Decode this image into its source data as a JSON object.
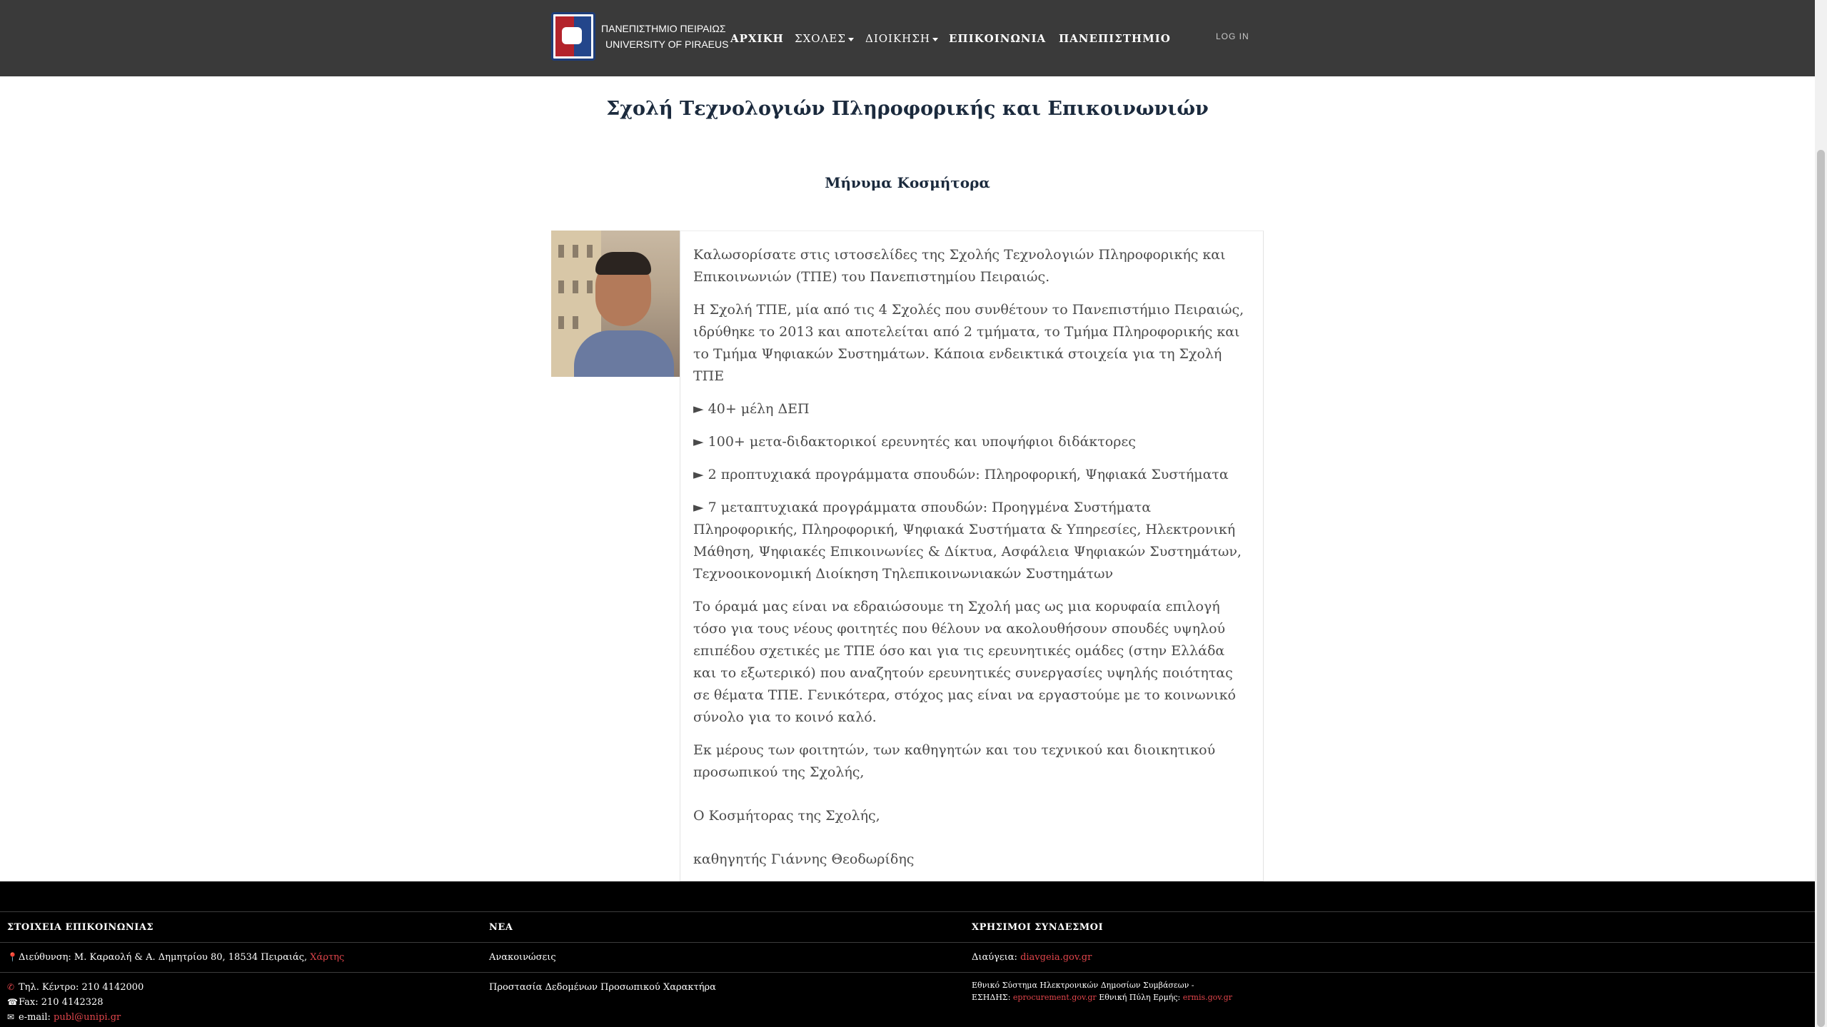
{
  "nav": {
    "brand_gr": "ΠΑΝΕΠΙΣΤΗΜΙΟ ΠΕΙΡΑΙΩΣ",
    "brand_en": "UNIVERSITY OF PIRAEUS",
    "items": [
      {
        "label": "ΑΡΧΙΚΗ"
      },
      {
        "label": "ΣΧΟΛΕΣ"
      },
      {
        "label": "ΔΙΟΙΚΗΣΗ"
      },
      {
        "label": "ΕΠΙΚΟΙΝΩΝΙΑ"
      },
      {
        "label": "ΠΑΝΕΠΙΣΤΗΜΙΟ"
      }
    ],
    "login": "LOG IN"
  },
  "page": {
    "title": "Σχολή Τεχνολογιών Πληροφορικής και Επικοινωνιών",
    "subtitle": "Μήνυμα Κοσμήτορα"
  },
  "message": {
    "p1": "Καλωσορίσατε στις ιστοσελίδες της Σχολής Τεχνολογιών Πληροφορικής και Επικοινωνιών (ΤΠΕ) του Πανεπιστημίου Πειραιώς.",
    "p2": "Η Σχολή ΤΠΕ, μία από τις 4 Σχολές που συνθέτουν το Πανεπιστήμιο Πειραιώς, ιδρύθηκε το 2013 και αποτελείται από 2 τμήματα, το Τμήμα Πληροφορικής και το Τμήμα Ψηφιακών Συστημάτων. Κάποια ενδεικτικά στοιχεία για τη Σχολή ΤΠΕ",
    "b1": "► 40+ μέλη ΔΕΠ",
    "b2": "► 100+ μετα-διδακτορικοί ερευνητές και υποψήφιοι διδάκτορες",
    "b3": "► 2 προπτυχιακά προγράμματα σπουδών: Πληροφορική, Ψηφιακά Συστήματα",
    "b4": "► 7 μεταπτυχιακά προγράμματα σπουδών: Προηγμένα Συστήματα Πληροφορικής, Πληροφορική, Ψηφιακά Συστήματα & Υπηρεσίες, Ηλεκτρονική Μάθηση, Ψηφιακές Επικοινωνίες & Δίκτυα, Ασφάλεια Ψηφιακών Συστημάτων, Τεχνοοικονομική Διοίκηση Τηλεπικοινωνιακών Συστημάτων",
    "p3": "Το όραμά μας είναι να εδραιώσουμε τη Σχολή μας ως μια κορυφαία επιλογή τόσο για τους νέους φοιτητές που θέλουν να ακολουθήσουν σπουδές υψηλού επιπέδου σχετικές με ΤΠΕ όσο και για τις ερευνητικές ομάδες (στην Ελλάδα και το εξωτερικό) που αναζητούν ερευνητικές συνεργασίες υψηλής ποιότητας σε θέματα ΤΠΕ. Γενικότερα, στόχος μας είναι να εργαστούμε με το κοινωνικό σύνολο για το κοινό καλό.",
    "p4": "Εκ μέρους των φοιτητών, των καθηγητών και του τεχνικού και διοικητικού προσωπικού της Σχολής,",
    "sign1": "Ο Κοσμήτορας της Σχολής,",
    "sign2": "καθηγητής Γιάννης Θεοδωρίδης"
  },
  "footer": {
    "contact_head": "ΣΤΟΙΧΕΙΑ ΕΠΙΚΟΙΝΩΝΙΑΣ",
    "news_head": "ΝΕΑ",
    "links_head": "ΧΡΗΣΙΜΟΙ ΣΥΝΔΕΣΜΟΙ",
    "address": "Διεύθυνση: Μ. Καραολή & Α. Δημητρίου 80, 18534 Πειραιάς,",
    "map_link": "Χάρτης",
    "phone": "Τηλ. Κέντρο: 210 4142000",
    "fax": "Fax: 210 4142328",
    "email_label": "e-mail:",
    "email": "publ@unipi.gr",
    "news1": "Ανακοινώσεις",
    "news2": "Προστασία Δεδομένων Προσωπικού Χαρακτήρα",
    "diavgeia_label": "Διαύγεια:",
    "diavgeia_link": "diavgeia.gov.gr",
    "esidis_line1": "Εθνικό Σύστημα Ηλεκτρονικών Δημοσίων Συμβάσεων -",
    "esidis_label": "ΕΣΗΔΗΣ:",
    "esidis_link": "eprocurement.gov.gr",
    "ermis_label": "Εθνική Πύλη Ερμής:",
    "ermis_link": "ermis.gov.gr"
  },
  "icons": {
    "location": "map-pin-icon",
    "phone": "phone-icon",
    "fax": "fax-icon",
    "email": "envelope-icon"
  },
  "colors": {
    "navbar": "#3a3a3a",
    "footer": "#000000",
    "link": "#e0454b",
    "title": "#1b2a3d"
  }
}
